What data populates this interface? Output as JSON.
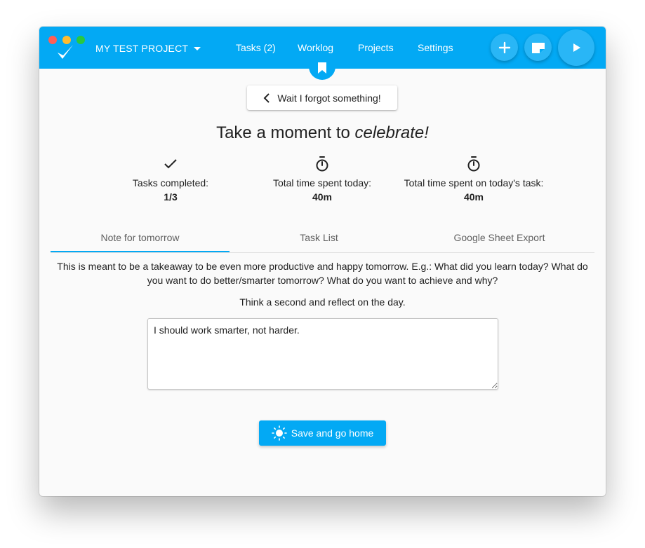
{
  "colors": {
    "primary": "#03a9f4",
    "fab": "#29b6f6",
    "background": "#fafafa",
    "text": "#212121",
    "muted_text": "#616161"
  },
  "window": {
    "traffic_lights": [
      "close",
      "minimize",
      "maximize"
    ]
  },
  "header": {
    "logo_icon": "checkmark-logo-icon",
    "project_name": "MY TEST PROJECT",
    "nav": [
      {
        "label": "Tasks (2)"
      },
      {
        "label": "Worklog"
      },
      {
        "label": "Projects"
      },
      {
        "label": "Settings"
      }
    ],
    "actions": [
      {
        "icon": "plus-icon"
      },
      {
        "icon": "note-icon"
      },
      {
        "icon": "play-icon"
      }
    ],
    "bookmark_icon": "bookmark-icon"
  },
  "main": {
    "back_button": {
      "label": "Wait I forgot something!",
      "icon": "chevron-left-icon"
    },
    "headline_prefix": "Take a moment to ",
    "headline_emphasis": "celebrate!",
    "stats": [
      {
        "icon": "check-icon",
        "label": "Tasks completed:",
        "value": "1/3"
      },
      {
        "icon": "stopwatch-icon",
        "label": "Total time spent today:",
        "value": "40m"
      },
      {
        "icon": "stopwatch-icon",
        "label": "Total time spent on today's task:",
        "value": "40m"
      }
    ],
    "tabs": [
      {
        "label": "Note for tomorrow",
        "active": true
      },
      {
        "label": "Task List",
        "active": false
      },
      {
        "label": "Google Sheet Export",
        "active": false
      }
    ],
    "description": "This is meant to be a takeaway to be even more productive and happy tomorrow. E.g.: What did you learn today? What do you want to do better/smarter tomorrow? What do you want to achieve and why?",
    "reflect_text": "Think a second and reflect on the day.",
    "note_value": "I should work smarter, not harder.",
    "save_button": {
      "label": "Save and go home",
      "icon": "sun-icon"
    }
  }
}
